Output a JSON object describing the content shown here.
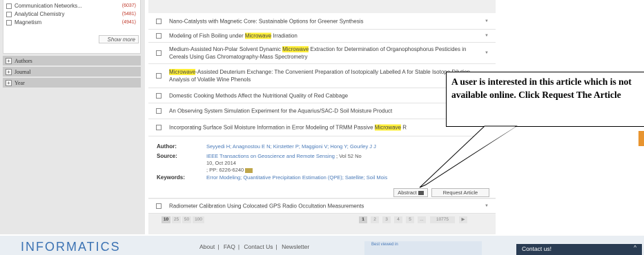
{
  "sidebar": {
    "facets": [
      {
        "label": "Communication Networks...",
        "count": "(6037)"
      },
      {
        "label": "Analytical Chemistry",
        "count": "(5481)"
      },
      {
        "label": "Magnetism",
        "count": "(4941)"
      }
    ],
    "show_more": "Show more",
    "headers": [
      {
        "label": "Authors",
        "toggle": "+"
      },
      {
        "label": "Journal",
        "toggle": "+"
      },
      {
        "label": "Year",
        "toggle": "+"
      }
    ]
  },
  "results": [
    {
      "pre": "Nano-Catalysts with Magnetic Core: Sustainable Options for Greener Synthesis",
      "hl": "",
      "post": ""
    },
    {
      "pre": "Modeling of Fish Boiling under ",
      "hl": "Microwave",
      "post": " Irradiation"
    },
    {
      "pre": "Medium-Assisted Non-Polar Solvent Dynamic ",
      "hl": "Microwave",
      "post": " Extraction for Determination of Organophosphorus Pesticides in Cereals Using Gas Chromatography-Mass Spectrometry"
    },
    {
      "pre": "",
      "hl": "Microwave",
      "post": "-Assisted Deuterium Exchange: The Convenient Preparation of Isotopically Labelled A for Stable Isotope Dilution Analysis of Volatile Wine Phenols"
    },
    {
      "pre": "Domestic Cooking Methods Affect the Nutritional Quality of Red Cabbage",
      "hl": "",
      "post": ""
    },
    {
      "pre": "An Observing System Simulation Experiment for the Aquarius/SAC-D Soil Moisture Product",
      "hl": "",
      "post": ""
    },
    {
      "pre": "Incorporating Surface Soil Moisture Information in Error Modeling of TRMM Passive ",
      "hl": "Microwave",
      "post": " R"
    },
    {
      "pre": "Radiometer Calibration Using Colocated GPS Radio Occultation Measurements",
      "hl": "",
      "post": ""
    }
  ],
  "detail": {
    "author_label": "Author:",
    "author_value": "Seyyedi H; Anagnostou E N; Kirstetter P; Maggioni V; Hong Y; Gourley J J",
    "source_label": "Source:",
    "source_journal": "IEEE Transactions on Geoscience and Remote Sensing",
    "source_rest": " ; Vol 52 No 10, Oct 2014",
    "source_pages": "; PP: 6226-6240",
    "keywords_label": "Keywords:",
    "keywords_value": "Error Modeling; Quantitative Precipitation Estimation (QPE); Satellite; Soil Mois",
    "abstract_btn": "Abstract",
    "request_btn": "Request Article"
  },
  "pager": {
    "sizes": [
      "10",
      "25",
      "50",
      "100"
    ],
    "pages": [
      "1",
      "2",
      "3",
      "4",
      "5",
      "...",
      "10775"
    ],
    "next": "▶"
  },
  "callout": {
    "text": "A user is interested in this article which is not available online. Click Request The Article"
  },
  "footer": {
    "logo": "INFORMATICS",
    "links": [
      "About",
      "FAQ",
      "Contact Us",
      "Newsletter"
    ],
    "separator": "|",
    "best_viewed": "Best viewed in",
    "contact": "Contact us!",
    "contact_caret": "^"
  },
  "colors": {
    "highlight": "#ffef3a",
    "link": "#4a7ab8",
    "count": "#c0392b",
    "contact_bg": "#2a3c53"
  }
}
